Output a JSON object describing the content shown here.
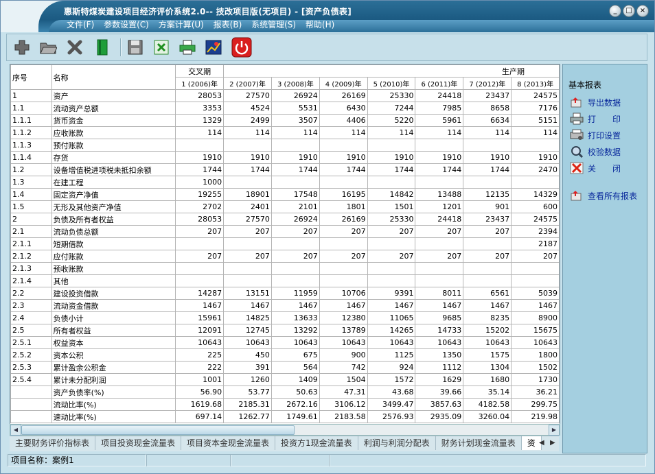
{
  "window": {
    "title": "惠斯特煤炭建设项目经济评价系统2.0-- 技改项目版(无项目) - [资产负债表]",
    "controls": [
      "_",
      "□",
      "×"
    ]
  },
  "menu": [
    "文件(F)",
    "参数设置(C)",
    "方案计算(U)",
    "报表(B)",
    "系统管理(S)",
    "帮助(H)"
  ],
  "toolbar": {
    "icons": [
      "add-icon",
      "open-folder-icon",
      "delete-icon",
      "book-icon",
      "save-icon",
      "excel-icon",
      "print-icon",
      "chart-icon",
      "power-icon"
    ]
  },
  "grid": {
    "col_seq": "序号",
    "col_name": "名称",
    "group_jiaocha": "交叉期",
    "group_shengchan": "生产期",
    "years": [
      "1 (2006)年",
      "2 (2007)年",
      "3 (2008)年",
      "4 (2009)年",
      "5 (2010)年",
      "6 (2011)年",
      "7 (2012)年",
      "8 (2013)年"
    ],
    "rows": [
      {
        "seq": "1",
        "name": "资产",
        "v": [
          "28053",
          "27570",
          "26924",
          "26169",
          "25330",
          "24418",
          "23437",
          "24575"
        ]
      },
      {
        "seq": "1.1",
        "name": "流动资产总额",
        "v": [
          "3353",
          "4524",
          "5531",
          "6430",
          "7244",
          "7985",
          "8658",
          "7176"
        ]
      },
      {
        "seq": "1.1.1",
        "name": "货币资金",
        "v": [
          "1329",
          "2499",
          "3507",
          "4406",
          "5220",
          "5961",
          "6634",
          "5151"
        ]
      },
      {
        "seq": "1.1.2",
        "name": "应收账款",
        "v": [
          "114",
          "114",
          "114",
          "114",
          "114",
          "114",
          "114",
          "114"
        ]
      },
      {
        "seq": "1.1.3",
        "name": "预付账款",
        "v": [
          "",
          "",
          "",
          "",
          "",
          "",
          "",
          ""
        ]
      },
      {
        "seq": "1.1.4",
        "name": "存货",
        "v": [
          "1910",
          "1910",
          "1910",
          "1910",
          "1910",
          "1910",
          "1910",
          "1910"
        ]
      },
      {
        "seq": "1.2",
        "name": "设备增值税进项税未抵扣余额",
        "v": [
          "1744",
          "1744",
          "1744",
          "1744",
          "1744",
          "1744",
          "1744",
          "2470"
        ]
      },
      {
        "seq": "1.3",
        "name": "在建工程",
        "v": [
          "1000",
          "",
          "",
          "",
          "",
          "",
          "",
          ""
        ]
      },
      {
        "seq": "1.4",
        "name": "固定资产净值",
        "v": [
          "19255",
          "18901",
          "17548",
          "16195",
          "14842",
          "13488",
          "12135",
          "14329"
        ]
      },
      {
        "seq": "1.5",
        "name": "无形及其他资产净值",
        "v": [
          "2702",
          "2401",
          "2101",
          "1801",
          "1501",
          "1201",
          "901",
          "600"
        ]
      },
      {
        "seq": "2",
        "name": "负债及所有者权益",
        "v": [
          "28053",
          "27570",
          "26924",
          "26169",
          "25330",
          "24418",
          "23437",
          "24575"
        ]
      },
      {
        "seq": "2.1",
        "name": "流动负债总额",
        "v": [
          "207",
          "207",
          "207",
          "207",
          "207",
          "207",
          "207",
          "2394"
        ]
      },
      {
        "seq": "2.1.1",
        "name": "短期借款",
        "v": [
          "",
          "",
          "",
          "",
          "",
          "",
          "",
          "2187"
        ]
      },
      {
        "seq": "2.1.2",
        "name": "应付账款",
        "v": [
          "207",
          "207",
          "207",
          "207",
          "207",
          "207",
          "207",
          "207"
        ]
      },
      {
        "seq": "2.1.3",
        "name": "预收账款",
        "v": [
          "",
          "",
          "",
          "",
          "",
          "",
          "",
          ""
        ]
      },
      {
        "seq": "2.1.4",
        "name": "其他",
        "v": [
          "",
          "",
          "",
          "",
          "",
          "",
          "",
          ""
        ]
      },
      {
        "seq": "2.2",
        "name": "建设投资借款",
        "v": [
          "14287",
          "13151",
          "11959",
          "10706",
          "9391",
          "8011",
          "6561",
          "5039"
        ]
      },
      {
        "seq": "2.3",
        "name": "流动资金借款",
        "v": [
          "1467",
          "1467",
          "1467",
          "1467",
          "1467",
          "1467",
          "1467",
          "1467"
        ]
      },
      {
        "seq": "2.4",
        "name": "负债小计",
        "v": [
          "15961",
          "14825",
          "13633",
          "12380",
          "11065",
          "9685",
          "8235",
          "8900"
        ]
      },
      {
        "seq": "2.5",
        "name": "所有者权益",
        "v": [
          "12091",
          "12745",
          "13292",
          "13789",
          "14265",
          "14733",
          "15202",
          "15675"
        ]
      },
      {
        "seq": "2.5.1",
        "name": "权益资本",
        "v": [
          "10643",
          "10643",
          "10643",
          "10643",
          "10643",
          "10643",
          "10643",
          "10643"
        ]
      },
      {
        "seq": "2.5.2",
        "name": "资本公积",
        "v": [
          "225",
          "450",
          "675",
          "900",
          "1125",
          "1350",
          "1575",
          "1800"
        ]
      },
      {
        "seq": "2.5.3",
        "name": "累计盈余公积金",
        "v": [
          "222",
          "391",
          "564",
          "742",
          "924",
          "1112",
          "1304",
          "1502"
        ]
      },
      {
        "seq": "2.5.4",
        "name": "累计未分配利润",
        "v": [
          "1001",
          "1260",
          "1409",
          "1504",
          "1572",
          "1629",
          "1680",
          "1730"
        ]
      },
      {
        "seq": "",
        "name": "资产负债率(%)",
        "v": [
          "56.90",
          "53.77",
          "50.63",
          "47.31",
          "43.68",
          "39.66",
          "35.14",
          "36.21"
        ]
      },
      {
        "seq": "",
        "name": "流动比率(%)",
        "v": [
          "1619.68",
          "2185.31",
          "2672.16",
          "3106.12",
          "3499.47",
          "3857.63",
          "4182.58",
          "299.75"
        ]
      },
      {
        "seq": "",
        "name": "速动比率(%)",
        "v": [
          "697.14",
          "1262.77",
          "1749.61",
          "2183.58",
          "2576.93",
          "2935.09",
          "3260.04",
          "219.98"
        ]
      }
    ]
  },
  "sheet_tabs": [
    "主要财务评价指标表",
    "项目投资现金流量表",
    "项目资本金现金流量表",
    "投资方1现金流量表",
    "利润与利润分配表",
    "财务计划现金流量表",
    "资"
  ],
  "right_panel": {
    "heading": "基本报表",
    "items": [
      {
        "label": "导出数据",
        "icon": "export-icon"
      },
      {
        "label": "打　　印",
        "icon": "printer-icon"
      },
      {
        "label": "打印设置",
        "icon": "print-settings-icon"
      },
      {
        "label": "校验数据",
        "icon": "verify-icon"
      },
      {
        "label": "关　　闭",
        "icon": "close-x-icon"
      },
      {
        "label": "查看所有报表",
        "icon": "view-reports-icon"
      }
    ]
  },
  "status": {
    "project_name": "项目名称：案例1"
  }
}
